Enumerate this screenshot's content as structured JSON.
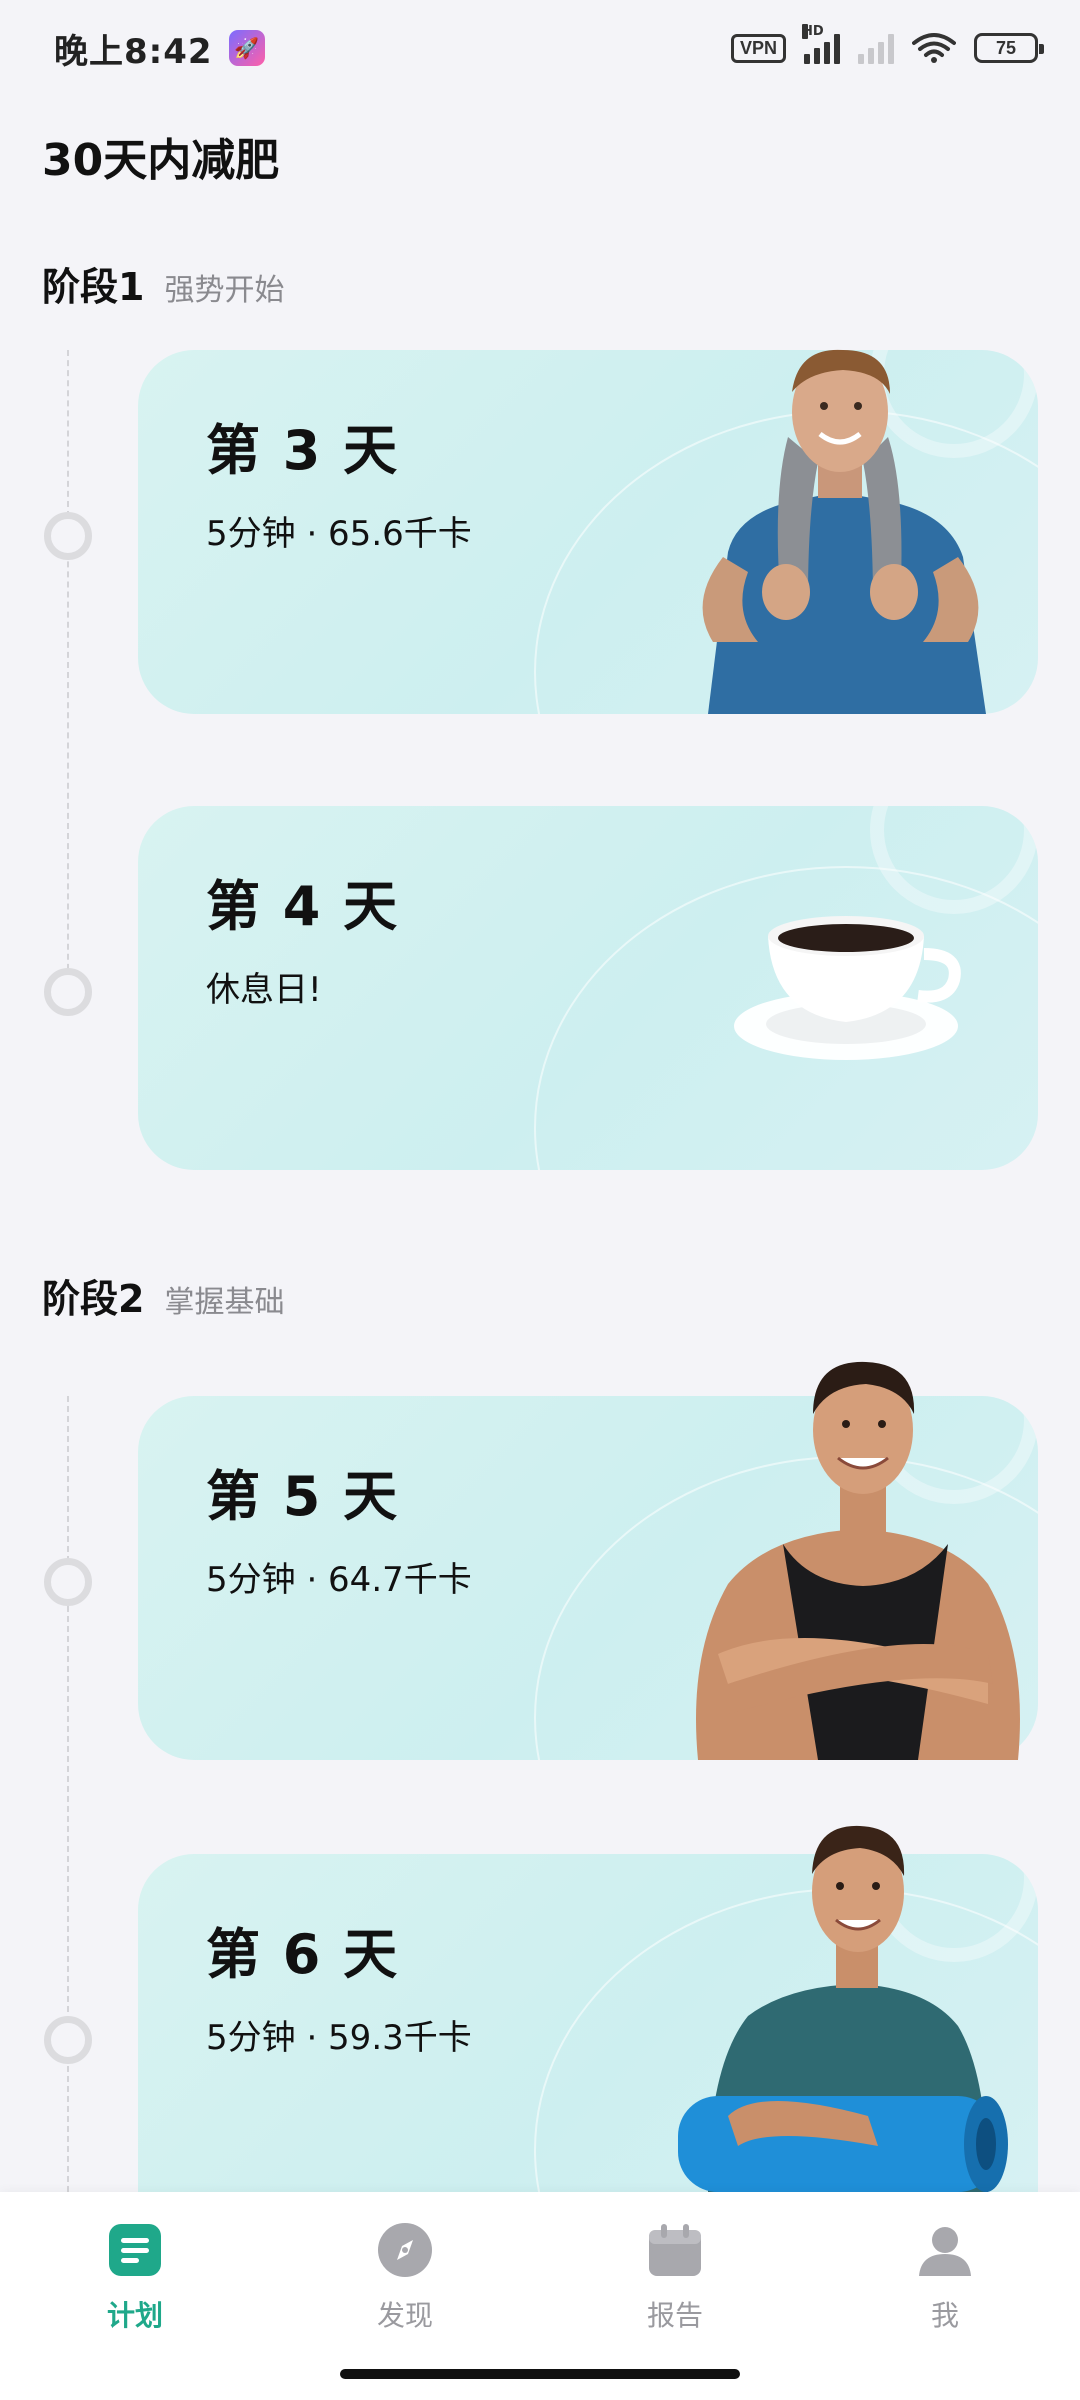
{
  "status_bar": {
    "time": "晚上8:42",
    "vpn": "VPN",
    "hd": "HD",
    "battery": "75"
  },
  "page": {
    "title": "30天内减肥"
  },
  "stages": [
    {
      "name": "阶段1",
      "subtitle": "强势开始",
      "days": [
        {
          "title": "第 3 天",
          "meta": "5分钟 · 65.6千卡",
          "illustration": "man-with-towel-photo"
        },
        {
          "title": "第 4 天",
          "meta": "休息日!",
          "illustration": "coffee-cup-photo"
        }
      ]
    },
    {
      "name": "阶段2",
      "subtitle": "掌握基础",
      "days": [
        {
          "title": "第 5 天",
          "meta": "5分钟 · 64.7千卡",
          "illustration": "man-arms-crossed-photo"
        },
        {
          "title": "第 6 天",
          "meta": "5分钟 · 59.3千卡",
          "illustration": "man-with-yoga-mat-photo"
        }
      ]
    }
  ],
  "bottom_nav": [
    {
      "label": "计划",
      "icon": "plan-icon",
      "active": true
    },
    {
      "label": "发现",
      "icon": "compass-icon",
      "active": false
    },
    {
      "label": "报告",
      "icon": "calendar-icon",
      "active": false
    },
    {
      "label": "我",
      "icon": "profile-icon",
      "active": false
    }
  ],
  "colors": {
    "accent": "#1fa88a",
    "card_bg": "#d3f1f1",
    "page_bg": "#f4f4f8"
  }
}
